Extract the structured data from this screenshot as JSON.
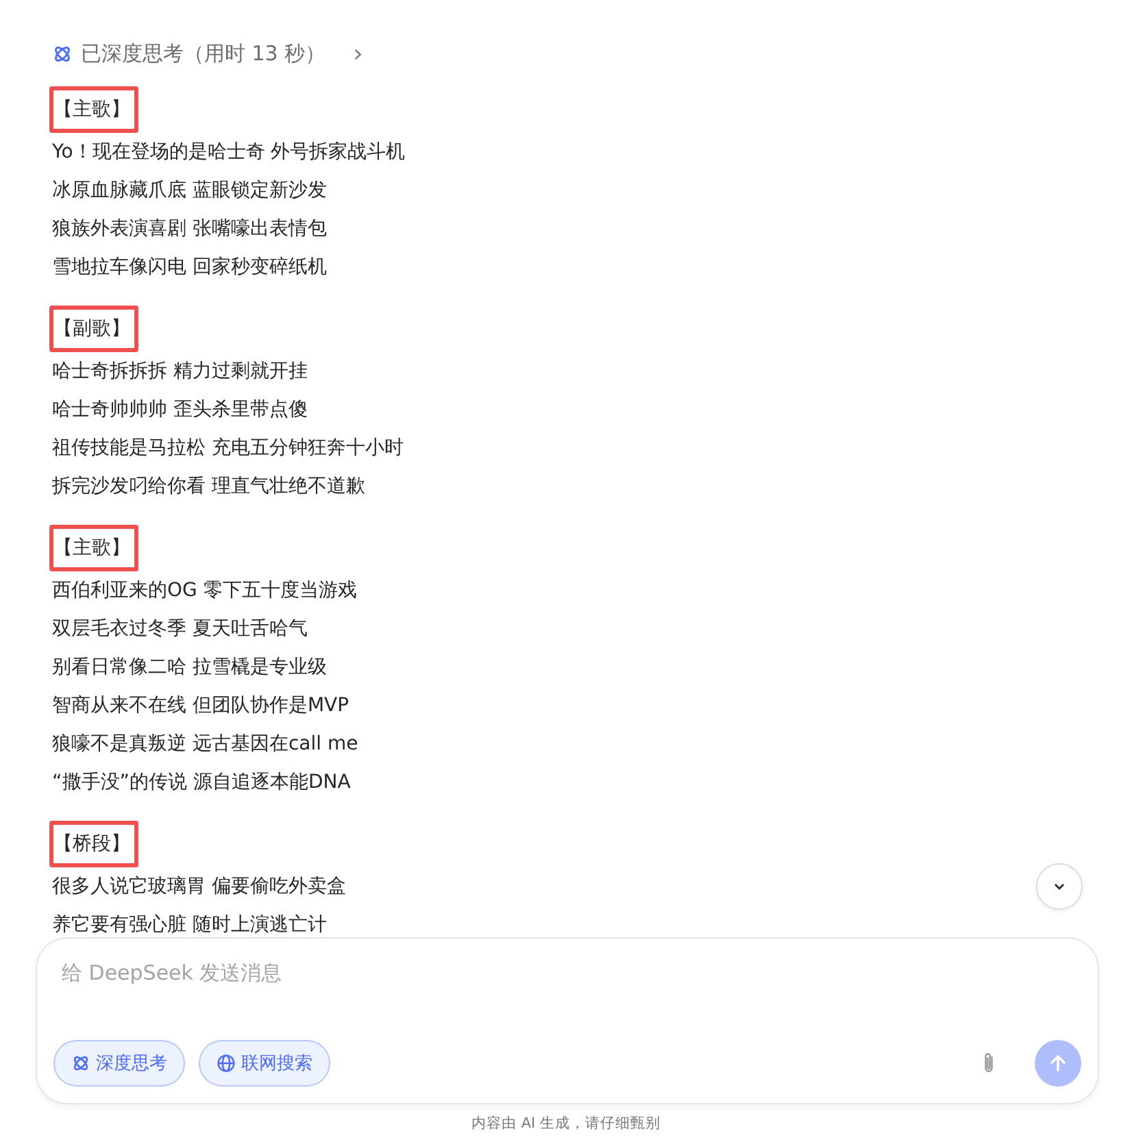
{
  "thinking": {
    "label": "已深度思考（用时 13 秒）",
    "chevron": "›"
  },
  "sections": [
    {
      "heading": "【主歌】",
      "lines": [
        "Yo！现在登场的是哈士奇 外号拆家战斗机",
        "冰原血脉藏爪底 蓝眼锁定新沙发",
        "狼族外表演喜剧 张嘴嚎出表情包",
        "雪地拉车像闪电 回家秒变碎纸机"
      ]
    },
    {
      "heading": "【副歌】",
      "lines": [
        "哈士奇拆拆拆 精力过剩就开挂",
        "哈士奇帅帅帅 歪头杀里带点傻",
        "祖传技能是马拉松 充电五分钟狂奔十小时",
        "拆完沙发叼给你看 理直气壮绝不道歉"
      ]
    },
    {
      "heading": "【主歌】",
      "lines": [
        "西伯利亚来的OG 零下五十度当游戏",
        "双层毛衣过冬季 夏天吐舌哈气",
        "别看日常像二哈 拉雪橇是专业级",
        "智商从来不在线 但团队协作是MVP",
        "狼嚎不是真叛逆 远古基因在call me",
        "“撒手没”的传说 源自追逐本能DNA"
      ]
    },
    {
      "heading": "【桥段】",
      "lines": [
        "很多人说它玻璃胃 偏要偷吃外卖盒",
        "养它要有强心脏 随时上演逃亡计"
      ]
    }
  ],
  "input": {
    "placeholder": "给 DeepSeek 发送消息"
  },
  "toggles": [
    {
      "label": "深度思考",
      "kind": "think",
      "selected": true
    },
    {
      "label": "联网搜索",
      "kind": "web",
      "selected": true
    }
  ],
  "footer": "内容由 AI 生成，请仔细甄别"
}
